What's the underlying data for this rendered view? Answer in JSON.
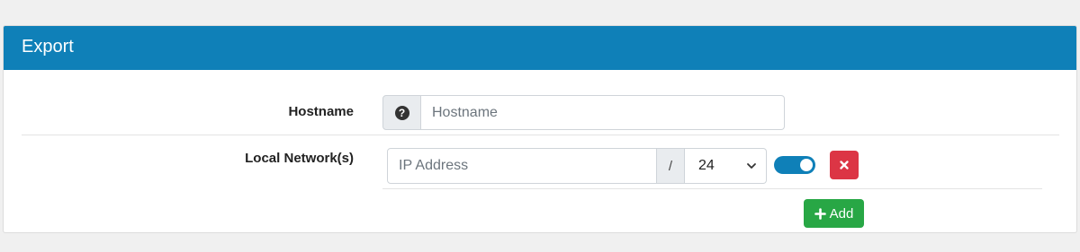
{
  "panel": {
    "title": "Export"
  },
  "hostname": {
    "label": "Hostname",
    "help_icon": "question-circle-icon",
    "placeholder": "Hostname",
    "value": ""
  },
  "local_network": {
    "label": "Local Network(s)",
    "rows": [
      {
        "ip_placeholder": "IP Address",
        "ip_value": "",
        "separator": "/",
        "prefix": "24",
        "enabled": true
      }
    ],
    "delete_icon": "times-icon",
    "add_button": {
      "icon": "plus-icon",
      "label": "Add"
    }
  },
  "colors": {
    "header": "#0f80b8",
    "toggle_on": "#0f80b8",
    "delete": "#dc3545",
    "add": "#28a745"
  }
}
